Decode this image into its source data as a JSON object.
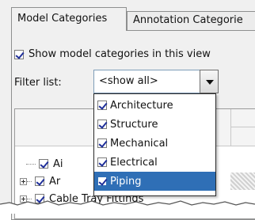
{
  "tabs": [
    {
      "label": "Model Categories"
    },
    {
      "label": "Annotation Categorie"
    }
  ],
  "show_checkbox": {
    "label": "Show model categories in this view",
    "checked": true
  },
  "filter": {
    "label": "Filter list:",
    "value": "<show all>"
  },
  "dropdown": {
    "items": [
      {
        "label": "Architecture",
        "checked": true,
        "selected": false
      },
      {
        "label": "Structure",
        "checked": true,
        "selected": false
      },
      {
        "label": "Mechanical",
        "checked": true,
        "selected": false
      },
      {
        "label": "Electrical",
        "checked": true,
        "selected": false
      },
      {
        "label": "Piping",
        "checked": true,
        "selected": true
      }
    ]
  },
  "tree": {
    "rows": [
      {
        "label": "Ai",
        "checked": true,
        "expandable": false
      },
      {
        "label": "Ar",
        "checked": true,
        "expandable": true
      },
      {
        "label": "Cable Tray Fittings",
        "checked": true,
        "expandable": true
      }
    ]
  },
  "colors": {
    "selection": "#2f6fb6",
    "check": "#1f2f9a"
  },
  "icons": [
    "checkbox-icon",
    "dropdown-arrow-icon",
    "tree-expander-icon"
  ]
}
